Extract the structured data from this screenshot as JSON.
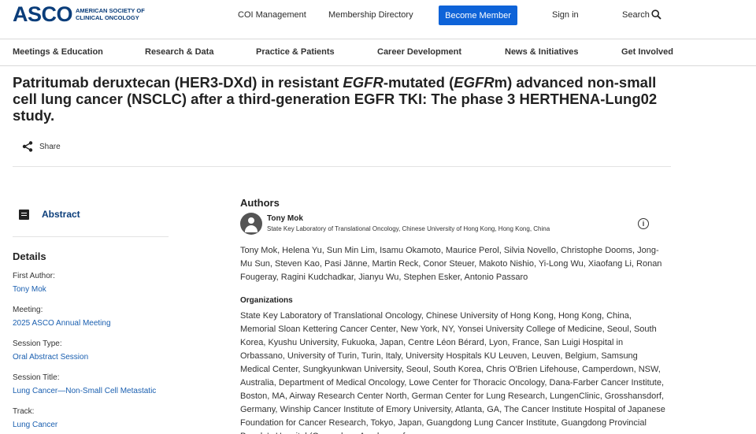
{
  "header": {
    "logo_word": "ASCO",
    "logo_sub": "American Society of Clinical Oncology",
    "coi_label": "COI Management",
    "directory_label": "Membership Directory",
    "become_member_label": "Become Member",
    "signin_label": "Sign in",
    "search_label": "Search"
  },
  "nav": {
    "items": [
      {
        "label": "Meetings & Education"
      },
      {
        "label": "Research & Data"
      },
      {
        "label": "Practice & Patients"
      },
      {
        "label": "Career Development"
      },
      {
        "label": "News & Initiatives"
      },
      {
        "label": "Get Involved"
      }
    ]
  },
  "article": {
    "title_part1": "Patritumab deruxtecan (HER3-DXd) in resistant ",
    "title_em1": "EGFR",
    "title_part2": "-mutated (",
    "title_em2": "EGFR",
    "title_part3": "m) advanced non-small cell lung cancer (NSCLC) after a third-generation EGFR TKI: The phase 3 HERTHENA-Lung02 study.",
    "share_label": "Share"
  },
  "sidebar": {
    "abstract_label": "Abstract",
    "details_heading": "Details",
    "details": [
      {
        "label": "First Author:",
        "value": "Tony Mok"
      },
      {
        "label": "Meeting:",
        "value": "2025 ASCO Annual Meeting"
      },
      {
        "label": "Session Type:",
        "value": "Oral Abstract Session"
      },
      {
        "label": "Session Title:",
        "value": "Lung Cancer—Non-Small Cell Metastatic"
      },
      {
        "label": "Track:",
        "value": "Lung Cancer"
      }
    ]
  },
  "authors": {
    "heading": "Authors",
    "first_author_name": "Tony Mok",
    "first_author_affiliation": "State Key Laboratory of Translational Oncology, Chinese University of Hong Kong, Hong Kong, China",
    "list": "Tony Mok, Helena Yu, Sun Min Lim, Isamu Okamoto, Maurice Perol, Silvia Novello, Christophe Dooms, Jong-Mu Sun, Steven Kao, Pasi Jänne, Martin Reck, Conor Steuer, Makoto Nishio, Yi-Long Wu, Xiaofang Li, Ronan Fougeray, Ragini Kudchadkar, Jianyu Wu, Stephen Esker, Antonio Passaro"
  },
  "organizations": {
    "heading": "Organizations",
    "text": "State Key Laboratory of Translational Oncology, Chinese University of Hong Kong, Hong Kong, China, Memorial Sloan Kettering Cancer Center, New York, NY, Yonsei University College of Medicine, Seoul, South Korea, Kyushu University, Fukuoka, Japan, Centre Léon Bérard, Lyon, France, San Luigi Hospital in Orbassano, University of Turin, Turin, Italy, University Hospitals KU Leuven, Leuven, Belgium, Samsung Medical Center, Sungkyunkwan University, Seoul, South Korea, Chris O'Brien Lifehouse, Camperdown, NSW, Australia, Department of Medical Oncology, Lowe Center for Thoracic Oncology, Dana-Farber Cancer Institute, Boston, MA, Airway Research Center North, German Center for Lung Research, LungenClinic, Grosshansdorf, Germany, Winship Cancer Institute of Emory University, Atlanta, GA, The Cancer Institute Hospital of Japanese Foundation for Cancer Research, Tokyo, Japan, Guangdong Lung Cancer Institute, Guangdong Provincial People's Hospital (Guangdong Academy of"
  },
  "colors": {
    "brand": "#0a3d7a",
    "button": "#0e63d8",
    "link": "#1a5fb0"
  }
}
